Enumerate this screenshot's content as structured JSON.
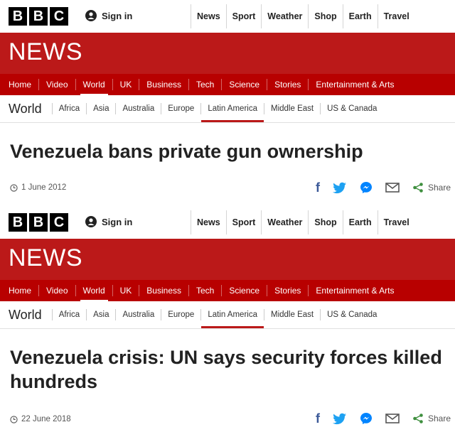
{
  "colors": {
    "brand_red": "#bb1919",
    "menu_red": "#b80000",
    "text": "#222222"
  },
  "panels": [
    {
      "logo": [
        "B",
        "B",
        "C"
      ],
      "sign_in": "Sign in",
      "top_nav": [
        "News",
        "Sport",
        "Weather",
        "Shop",
        "Earth",
        "Travel"
      ],
      "news_label": "NEWS",
      "main_menu": [
        "Home",
        "Video",
        "World",
        "UK",
        "Business",
        "Tech",
        "Science",
        "Stories",
        "Entertainment & Arts"
      ],
      "main_menu_active": "World",
      "section": "World",
      "sub_nav": [
        "Africa",
        "Asia",
        "Australia",
        "Europe",
        "Latin America",
        "Middle East",
        "US & Canada"
      ],
      "sub_nav_active": "Latin America",
      "headline": "Venezuela bans private gun ownership",
      "date": "1 June 2012",
      "share_label": "Share",
      "share_icons": [
        "facebook-icon",
        "twitter-icon",
        "messenger-icon",
        "email-icon",
        "share-icon"
      ]
    },
    {
      "logo": [
        "B",
        "B",
        "C"
      ],
      "sign_in": "Sign in",
      "top_nav": [
        "News",
        "Sport",
        "Weather",
        "Shop",
        "Earth",
        "Travel"
      ],
      "news_label": "NEWS",
      "main_menu": [
        "Home",
        "Video",
        "World",
        "UK",
        "Business",
        "Tech",
        "Science",
        "Stories",
        "Entertainment & Arts"
      ],
      "main_menu_active": "World",
      "section": "World",
      "sub_nav": [
        "Africa",
        "Asia",
        "Australia",
        "Europe",
        "Latin America",
        "Middle East",
        "US & Canada"
      ],
      "sub_nav_active": "Latin America",
      "headline": "Venezuela crisis: UN says security forces killed hundreds",
      "date": "22 June 2018",
      "share_label": "Share",
      "share_icons": [
        "facebook-icon",
        "twitter-icon",
        "messenger-icon",
        "email-icon",
        "share-icon"
      ]
    }
  ]
}
